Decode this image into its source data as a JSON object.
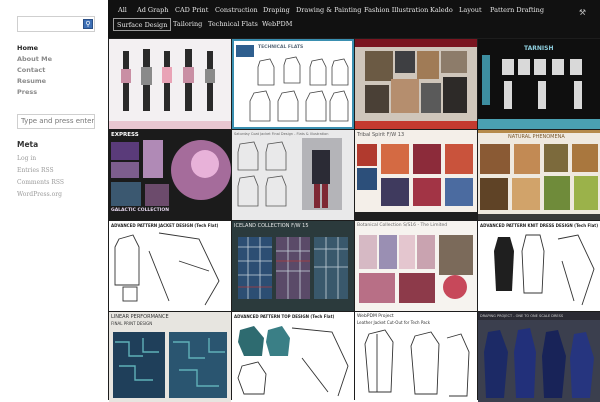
{
  "sidebar": {
    "search_button_icon": "search-icon",
    "nav": [
      "Home",
      "About Me",
      "Contact",
      "Resume",
      "Press"
    ],
    "active_nav": "Home",
    "search_placeholder": "Type and press enter t",
    "meta": {
      "title": "Meta",
      "links": [
        "Log in",
        "Entries RSS",
        "Comments RSS",
        "WordPress.org"
      ]
    }
  },
  "topnav": {
    "categories": [
      "All",
      "Ad Graph",
      "CAD Print",
      "Construction",
      "Draping",
      "Drawing & Painting",
      "Fashion Illustration",
      "Kaledo",
      "Layout",
      "Pattern Drafting",
      "Surface Design",
      "Tailoring",
      "Technical Flats",
      "WebPDM"
    ],
    "current": "Surface Design",
    "tool_icon": "wrench-icon"
  },
  "tiles": [
    {
      "title": "",
      "caption": ""
    },
    {
      "title": "TECHNICAL FLATS",
      "caption": ""
    },
    {
      "title": "",
      "caption": ""
    },
    {
      "title": "TARNISH",
      "caption": ""
    },
    {
      "title": "EXPRESS",
      "caption": "GALACTIC COLLECTION"
    },
    {
      "title": "Saturday Coat Jacket Final Design - Flats & Illustration",
      "caption": ""
    },
    {
      "title": "Tribal Spirit F/W 13",
      "caption": ""
    },
    {
      "title": "NATURAL PHENOMENA",
      "caption": ""
    },
    {
      "title": "ADVANCED PATTERN JACKET DESIGN (Tech Flat)",
      "caption": ""
    },
    {
      "title": "ICELAND COLLECTION F/W 15",
      "caption": ""
    },
    {
      "title": "Botanical Collection S/S16 - The Limited",
      "caption": ""
    },
    {
      "title": "ADVANCED PATTERN KNIT DRESS DESIGN (Tech Flat)",
      "caption": ""
    },
    {
      "title": "LINEAR PERFORMANCE",
      "caption": "FINAL PRINT DESIGN"
    },
    {
      "title": "ADVANCED PATTERN TOP DESIGN (Tech Flat)",
      "caption": ""
    },
    {
      "title": "WebPDM Project",
      "caption": "Leather Jacket Cut-Out for Tech Pack"
    },
    {
      "title": "DRAPING PROJECT - ONE TO ONE SCALE DRESS",
      "caption": ""
    }
  ]
}
